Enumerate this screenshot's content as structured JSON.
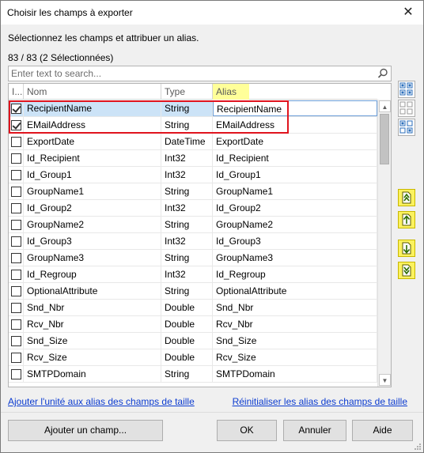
{
  "window": {
    "title": "Choisir les champs à exporter",
    "close_glyph": "✕"
  },
  "instruction": "Sélectionnez les champs et attribuer un alias.",
  "count_text": "83 / 83 (2 Sélectionnées)",
  "search": {
    "placeholder": "Enter text to search...",
    "value": ""
  },
  "grid": {
    "columns": [
      "I...",
      "Nom",
      "Type",
      "Alias"
    ],
    "rows": [
      {
        "checked": true,
        "name": "RecipientName",
        "type": "String",
        "alias": "RecipientName"
      },
      {
        "checked": true,
        "name": "EMailAddress",
        "type": "String",
        "alias": "EMailAddress"
      },
      {
        "checked": false,
        "name": "ExportDate",
        "type": "DateTime",
        "alias": "ExportDate"
      },
      {
        "checked": false,
        "name": "Id_Recipient",
        "type": "Int32",
        "alias": "Id_Recipient"
      },
      {
        "checked": false,
        "name": "Id_Group1",
        "type": "Int32",
        "alias": "Id_Group1"
      },
      {
        "checked": false,
        "name": "GroupName1",
        "type": "String",
        "alias": "GroupName1"
      },
      {
        "checked": false,
        "name": "Id_Group2",
        "type": "Int32",
        "alias": "Id_Group2"
      },
      {
        "checked": false,
        "name": "GroupName2",
        "type": "String",
        "alias": "GroupName2"
      },
      {
        "checked": false,
        "name": "Id_Group3",
        "type": "Int32",
        "alias": "Id_Group3"
      },
      {
        "checked": false,
        "name": "GroupName3",
        "type": "String",
        "alias": "GroupName3"
      },
      {
        "checked": false,
        "name": "Id_Regroup",
        "type": "Int32",
        "alias": "Id_Regroup"
      },
      {
        "checked": false,
        "name": "OptionalAttribute",
        "type": "String",
        "alias": "OptionalAttribute"
      },
      {
        "checked": false,
        "name": "Snd_Nbr",
        "type": "Double",
        "alias": "Snd_Nbr"
      },
      {
        "checked": false,
        "name": "Rcv_Nbr",
        "type": "Double",
        "alias": "Rcv_Nbr"
      },
      {
        "checked": false,
        "name": "Snd_Size",
        "type": "Double",
        "alias": "Snd_Size"
      },
      {
        "checked": false,
        "name": "Rcv_Size",
        "type": "Double",
        "alias": "Rcv_Size"
      },
      {
        "checked": false,
        "name": "SMTPDomain",
        "type": "String",
        "alias": "SMTPDomain"
      }
    ]
  },
  "side_buttons": [
    "select-all-icon",
    "deselect-all-icon",
    "invert-selection-icon",
    "move-top-icon",
    "move-up-icon",
    "move-down-icon",
    "move-bottom-icon"
  ],
  "links": {
    "add_unit": "Ajouter l'unité aux alias des champs de taille",
    "reset_alias": "Réinitialiser les alias des champs de taille"
  },
  "buttons": {
    "add_field": "Ajouter un champ...",
    "ok": "OK",
    "cancel": "Annuler",
    "help": "Aide"
  },
  "colors": {
    "highlight": "#ffff99",
    "selection": "#cce3f7",
    "red_frame": "#e0141e",
    "link": "#0b3bd0",
    "side_yellow": "#fbf25f"
  }
}
